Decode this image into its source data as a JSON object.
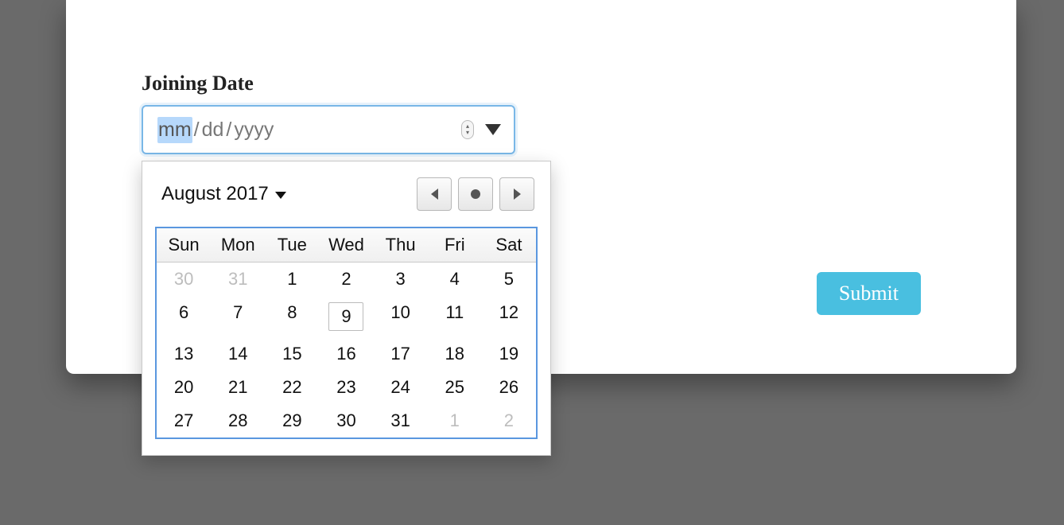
{
  "form": {
    "label": "Joining Date",
    "submit_label": "Submit"
  },
  "date_input": {
    "segments": {
      "mm": "mm",
      "dd": "dd",
      "yyyy": "yyyy"
    },
    "separator": "/"
  },
  "calendar": {
    "month_year": "August 2017",
    "weekdays": [
      "Sun",
      "Mon",
      "Tue",
      "Wed",
      "Thu",
      "Fri",
      "Sat"
    ],
    "today": 9,
    "cells": [
      {
        "n": 30,
        "outside": true
      },
      {
        "n": 31,
        "outside": true
      },
      {
        "n": 1
      },
      {
        "n": 2
      },
      {
        "n": 3
      },
      {
        "n": 4
      },
      {
        "n": 5
      },
      {
        "n": 6
      },
      {
        "n": 7
      },
      {
        "n": 8
      },
      {
        "n": 9
      },
      {
        "n": 10
      },
      {
        "n": 11
      },
      {
        "n": 12
      },
      {
        "n": 13
      },
      {
        "n": 14
      },
      {
        "n": 15
      },
      {
        "n": 16
      },
      {
        "n": 17
      },
      {
        "n": 18
      },
      {
        "n": 19
      },
      {
        "n": 20
      },
      {
        "n": 21
      },
      {
        "n": 22
      },
      {
        "n": 23
      },
      {
        "n": 24
      },
      {
        "n": 25
      },
      {
        "n": 26
      },
      {
        "n": 27
      },
      {
        "n": 28
      },
      {
        "n": 29
      },
      {
        "n": 30
      },
      {
        "n": 31
      },
      {
        "n": 1,
        "outside": true
      },
      {
        "n": 2,
        "outside": true
      }
    ]
  }
}
